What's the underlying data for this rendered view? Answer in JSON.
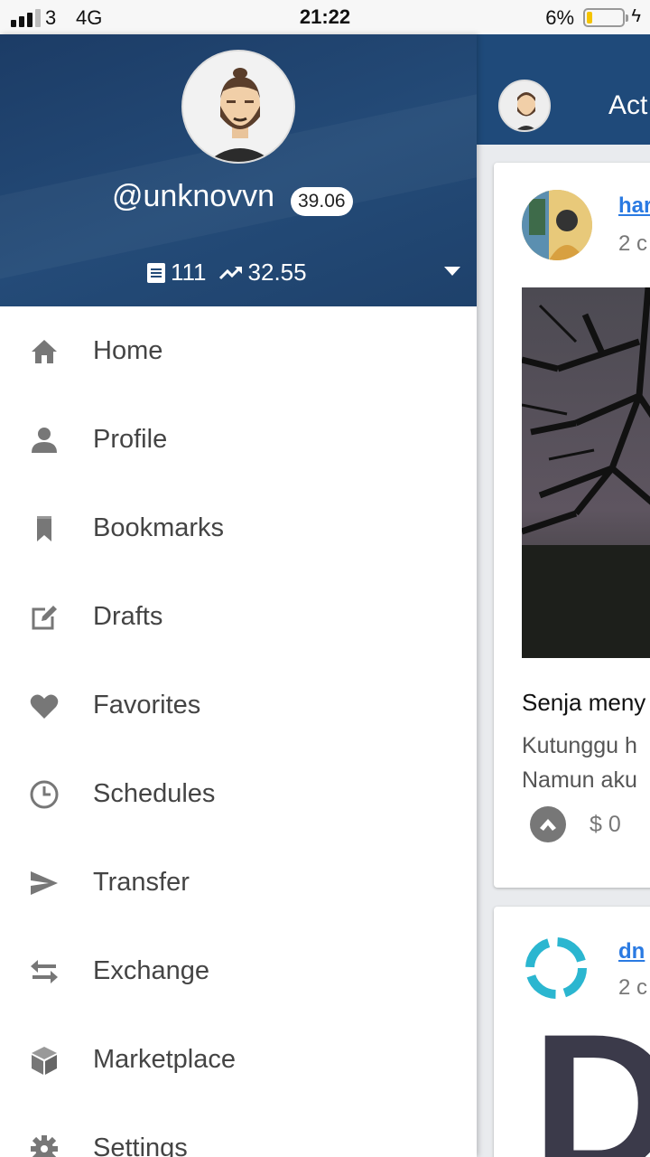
{
  "status_bar": {
    "carrier": "3",
    "network": "4G",
    "time": "21:22",
    "battery_percent": "6%",
    "battery_level": 0.06
  },
  "drawer": {
    "username": "@unknovvn",
    "reputation": "39.06",
    "post_count": "111",
    "voting_power": "32.55",
    "menu": [
      {
        "label": "Home",
        "icon": "home-icon"
      },
      {
        "label": "Profile",
        "icon": "person-icon"
      },
      {
        "label": "Bookmarks",
        "icon": "bookmark-icon"
      },
      {
        "label": "Drafts",
        "icon": "edit-icon"
      },
      {
        "label": "Favorites",
        "icon": "heart-icon"
      },
      {
        "label": "Schedules",
        "icon": "clock-icon"
      },
      {
        "label": "Transfer",
        "icon": "send-icon"
      },
      {
        "label": "Exchange",
        "icon": "exchange-icon"
      },
      {
        "label": "Marketplace",
        "icon": "cube-icon"
      },
      {
        "label": "Settings",
        "icon": "gear-icon"
      }
    ]
  },
  "feed": {
    "header_title": "Act",
    "cards": [
      {
        "author": "har",
        "time": "2 c",
        "title": "Senja meny",
        "body_line1": "Kutunggu h",
        "body_line2": "Namun aku",
        "payout": "$ 0"
      },
      {
        "author": "dn",
        "time": "2 c",
        "big_letter": "D"
      }
    ]
  },
  "colors": {
    "header_blue": "#1f4a7a",
    "link_blue": "#2a7ae2",
    "menu_text": "#444444",
    "icon_gray": "#777777"
  }
}
